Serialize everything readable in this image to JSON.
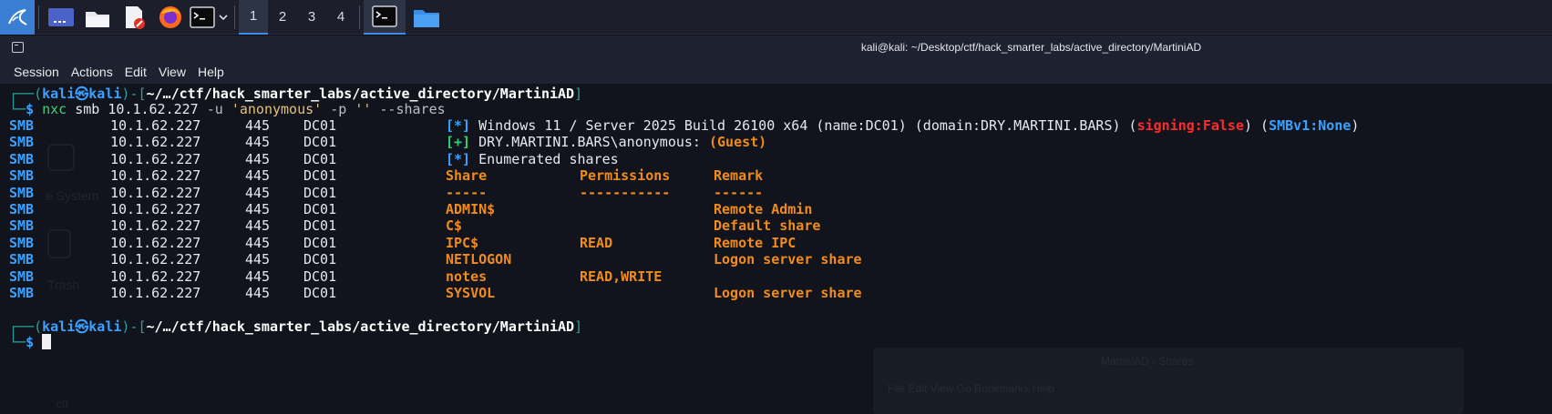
{
  "panel": {
    "workspaces": [
      "1",
      "2",
      "3",
      "4"
    ],
    "icons": [
      "kali-menu-icon",
      "desktop-icon",
      "file-manager-icon",
      "text-editor-icon",
      "firefox-icon",
      "terminal-icon",
      "folder-icon"
    ]
  },
  "window": {
    "title": "kali@kali: ~/Desktop/ctf/hack_smarter_labs/active_directory/MartiniAD"
  },
  "menu": [
    "Session",
    "Actions",
    "Edit",
    "View",
    "Help"
  ],
  "desktop_ghost": {
    "file_system": "e System",
    "trash": "Trash",
    "ctf": "ctf",
    "behind_window_title": "MartiniAD - Shares",
    "behind_menu": "File  Edit  View  Go  Bookmarks  Help"
  },
  "terminal": {
    "prompt": {
      "open": "┌──(",
      "user": "kali",
      "at": "㉿",
      "host": "kali",
      "mid": ")-[",
      "path": "~/…/ctf/hack_smarter_labs/active_directory/MartiniAD",
      "close": "]",
      "corner": "└─",
      "dollar": "$"
    },
    "command": {
      "bin": "nxc",
      "args_a": " smb 10.1.62.227 ",
      "flag_u": "-u",
      "user_arg": "'anonymous'",
      "flag_p": "-p",
      "pass_arg": "''",
      "flag_shares": "--shares"
    },
    "proto": "SMB",
    "ip": "10.1.62.227",
    "port": "445",
    "host": "DC01",
    "info_lines": [
      {
        "tag": "[*]",
        "text": " Windows 11 / Server 2025 Build 26100 x64 (name:DC01) (domain:DRY.MARTINI.BARS) (",
        "signing": "signing:False",
        "mid": ") (",
        "smbv1": "SMBv1:None",
        "end": ")"
      },
      {
        "tag": "[+]",
        "text": " DRY.MARTINI.BARS\\anonymous: ",
        "guest": "(Guest)"
      },
      {
        "tag": "[*]",
        "text": " Enumerated shares"
      }
    ],
    "share_headers": {
      "share": "Share",
      "perms": "Permissions",
      "remark": "Remark"
    },
    "share_underlines": {
      "share": "-----",
      "perms": "-----------",
      "remark": "------"
    },
    "shares": [
      {
        "name": "ADMIN$",
        "perms": "",
        "remark": "Remote Admin"
      },
      {
        "name": "C$",
        "perms": "",
        "remark": "Default share"
      },
      {
        "name": "IPC$",
        "perms": "READ",
        "remark": "Remote IPC"
      },
      {
        "name": "NETLOGON",
        "perms": "",
        "remark": "Logon server share"
      },
      {
        "name": "notes",
        "perms": "READ,WRITE",
        "remark": ""
      },
      {
        "name": "SYSVOL",
        "perms": "",
        "remark": "Logon server share"
      }
    ]
  },
  "colors": {
    "accent": "#3b8ee8",
    "terminal_bg": "#11141c",
    "prompt_blue": "#2f8fe8",
    "share_orange": "#f08c1d",
    "signing_red": "#ff2b2b",
    "success_green": "#2fd06f"
  }
}
